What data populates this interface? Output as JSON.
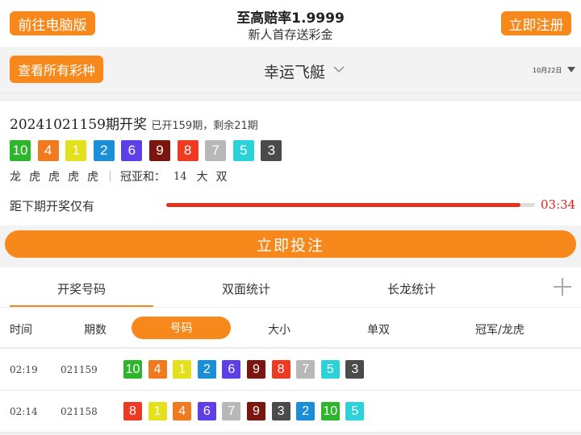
{
  "header": {
    "pc_button": "前往电脑版",
    "title": "至高赔率1.9999",
    "subtitle": "新人首存送彩金",
    "register_button": "立即注册"
  },
  "lottery_bar": {
    "all_button": "查看所有彩种",
    "lottery_name": "幸运飞艇",
    "date": "10月22日"
  },
  "current_draw": {
    "period": "20241021159期开奖",
    "info": "已开159期，剩余21期",
    "numbers": [
      10,
      4,
      1,
      2,
      6,
      9,
      8,
      7,
      5,
      3
    ],
    "dragon_tiger": [
      "龙",
      "虎",
      "虎",
      "虎",
      "虎"
    ],
    "sum_label": "冠亚和：",
    "sum_value": "14",
    "sum_size": "大",
    "sum_parity": "双",
    "countdown_label": "距下期开奖仅有",
    "countdown_time": "03:34",
    "countdown_progress": 0.96
  },
  "bet_button": "立即投注",
  "tabs": [
    "开奖号码",
    "双面统计",
    "长龙统计"
  ],
  "table": {
    "columns": [
      "时间",
      "期数",
      "号码",
      "大小",
      "单双",
      "冠军/龙虎"
    ],
    "rows": [
      {
        "time": "02:19",
        "period": "021159",
        "numbers": [
          10,
          4,
          1,
          2,
          6,
          9,
          8,
          7,
          5,
          3
        ]
      },
      {
        "time": "02:14",
        "period": "021158",
        "numbers": [
          8,
          1,
          4,
          6,
          7,
          9,
          3,
          2,
          10,
          5
        ]
      }
    ]
  },
  "ball_colors": {
    "1": "#e5e01c",
    "2": "#1a8ed6",
    "3": "#4b4b4b",
    "4": "#f07b1e",
    "5": "#2bd3d8",
    "6": "#5e3fe6",
    "7": "#b8b8b8",
    "8": "#ee3a22",
    "9": "#7a150f",
    "10": "#2db52b"
  }
}
